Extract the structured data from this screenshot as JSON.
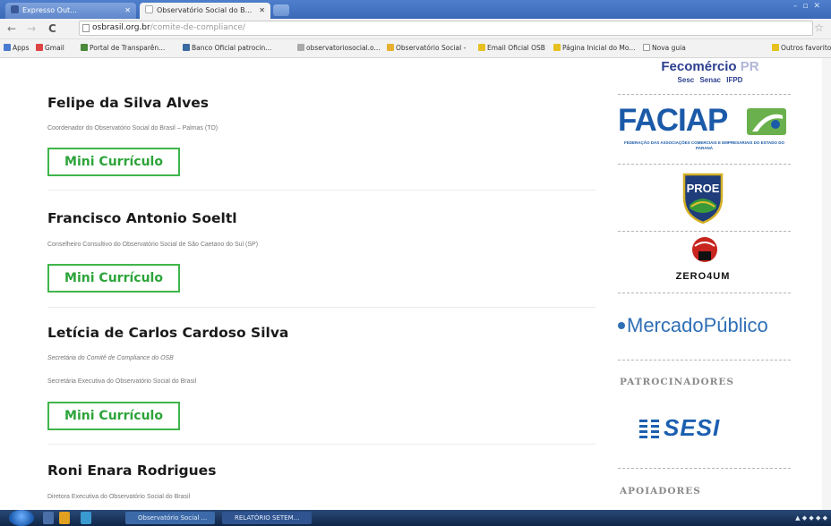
{
  "browser": {
    "tabs": [
      {
        "label": "Expresso Out..."
      },
      {
        "label": "Observatório Social do B..."
      }
    ],
    "url_host": "osbrasil.org.br",
    "url_path": "/comite-de-compliance/",
    "bookmarks": [
      "Apps",
      "Gmail",
      "Portal de Transparên...",
      "Banco Oficial patrocin...",
      "observatoriosocial.o...",
      "Observatório Social -",
      "Email Oficial OSB",
      "Página Inicial do Mo...",
      "Nova guia",
      "Outros favoritos"
    ]
  },
  "people": [
    {
      "name": "Felipe da Silva Alves",
      "roles": [
        "Coordenador do Observatório Social do Brasil – Palmas (TO)"
      ],
      "button": "Mini Currículo"
    },
    {
      "name": "Francisco Antonio Soeltl",
      "roles": [
        "Conselheiro Consultivo do Observatório Social de São Caetano do Sul (SP)"
      ],
      "button": "Mini Currículo"
    },
    {
      "name": "Letícia de Carlos Cardoso Silva",
      "roles": [
        "Secretária do Comitê de Compliance do OSB",
        "Secretária Executiva do Observatório Social do Brasil"
      ],
      "button": "Mini Currículo"
    },
    {
      "name": "Roni Enara Rodrigues",
      "roles": [
        "Diretora Executiva do Observatório Social do Brasil"
      ],
      "button": ""
    }
  ],
  "sidebar": {
    "fecomercio": {
      "main": "Fecomércio",
      "suffix": "PR",
      "sub": "Sesc  Senac  IFPD"
    },
    "faciap": {
      "main": "FACIAP",
      "sub": "FEDERAÇÃO DAS ASSOCIAÇÕES COMERCIAIS E EMPRESARIAIS DO ESTADO DO PARANÁ"
    },
    "proe": {
      "main": "PROE"
    },
    "zero4um": {
      "main": "ZERO4UM"
    },
    "mercadopublico": {
      "main": "MercadoPúblico"
    },
    "patrocinadores_heading": "PATROCINADORES",
    "sesi": {
      "main": "SESI"
    },
    "apoiadores_heading": "APOIADORES"
  },
  "taskbar": {
    "items": [
      "Observatório Social ...",
      "RELATÓRIO SETEM..."
    ]
  },
  "colors": {
    "accent_green": "#3fb54b",
    "faciap_blue": "#1b5aa8",
    "faciap_green": "#6ab04c",
    "sesi_blue": "#1c5fb0",
    "proe_shield": "#1e3d7a",
    "zero4um_red": "#c8251e"
  }
}
